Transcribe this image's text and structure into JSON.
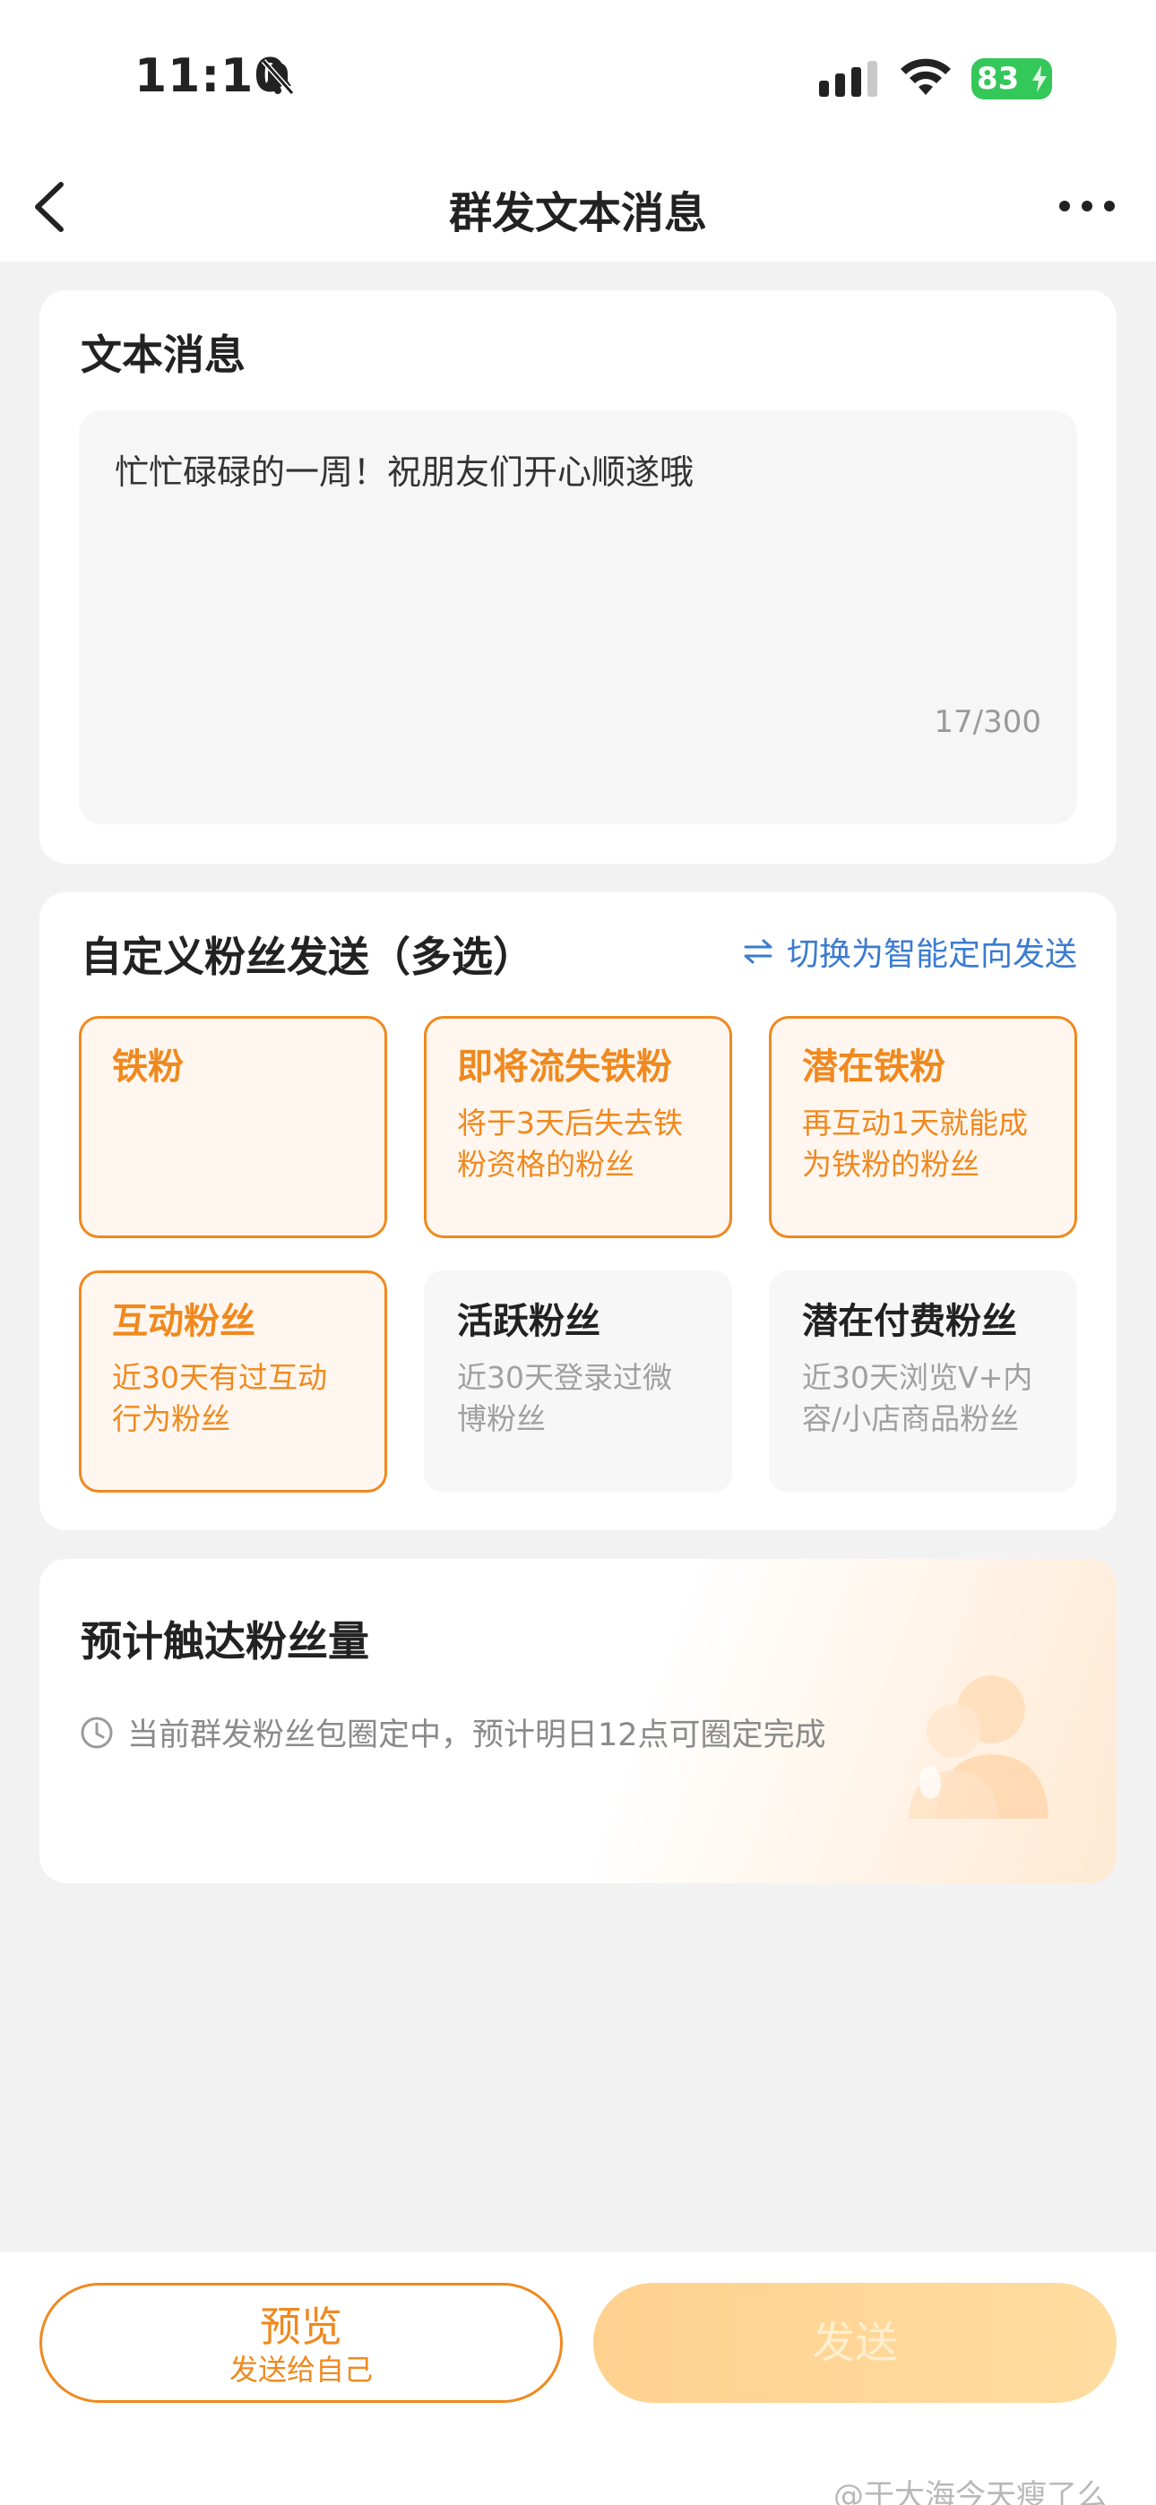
{
  "status_bar": {
    "time": "11:10",
    "battery": "83",
    "icons": [
      "bell-slash-icon",
      "signal-icon",
      "wifi-icon",
      "battery-icon"
    ]
  },
  "nav": {
    "title": "群发文本消息",
    "back_icon": "chevron-left-icon",
    "more_icon": "more-icon"
  },
  "message": {
    "section_title": "文本消息",
    "text": "忙忙碌碌的一周！祝朋友们开心顺遂哦",
    "counter": "17/300"
  },
  "fans": {
    "section_title": "自定义粉丝发送（多选）",
    "switch_label": "切换为智能定向发送",
    "options": [
      {
        "name": "铁粉",
        "desc": "",
        "selected": true
      },
      {
        "name": "即将流失铁粉",
        "desc": "将于3天后失去铁粉资格的粉丝",
        "selected": true
      },
      {
        "name": "潜在铁粉",
        "desc": "再互动1天就能成为铁粉的粉丝",
        "selected": true
      },
      {
        "name": "互动粉丝",
        "desc": "近30天有过互动行为粉丝",
        "selected": true
      },
      {
        "name": "活跃粉丝",
        "desc": "近30天登录过微博粉丝",
        "selected": false
      },
      {
        "name": "潜在付费粉丝",
        "desc": "近30天浏览V+内容/小店商品粉丝",
        "selected": false
      }
    ]
  },
  "reach": {
    "section_title": "预计触达粉丝量",
    "note": "当前群发粉丝包圈定中，预计明日12点可圈定完成"
  },
  "actions": {
    "preview_label": "预览",
    "preview_sub": "发送给自己",
    "send_label": "发送"
  },
  "watermark": "@于大海今天瘦了么",
  "colors": {
    "accent": "#f0891e",
    "link": "#3b7bd0",
    "selected_bg": "#fff6ef",
    "send_disabled": "#ffd18f"
  }
}
